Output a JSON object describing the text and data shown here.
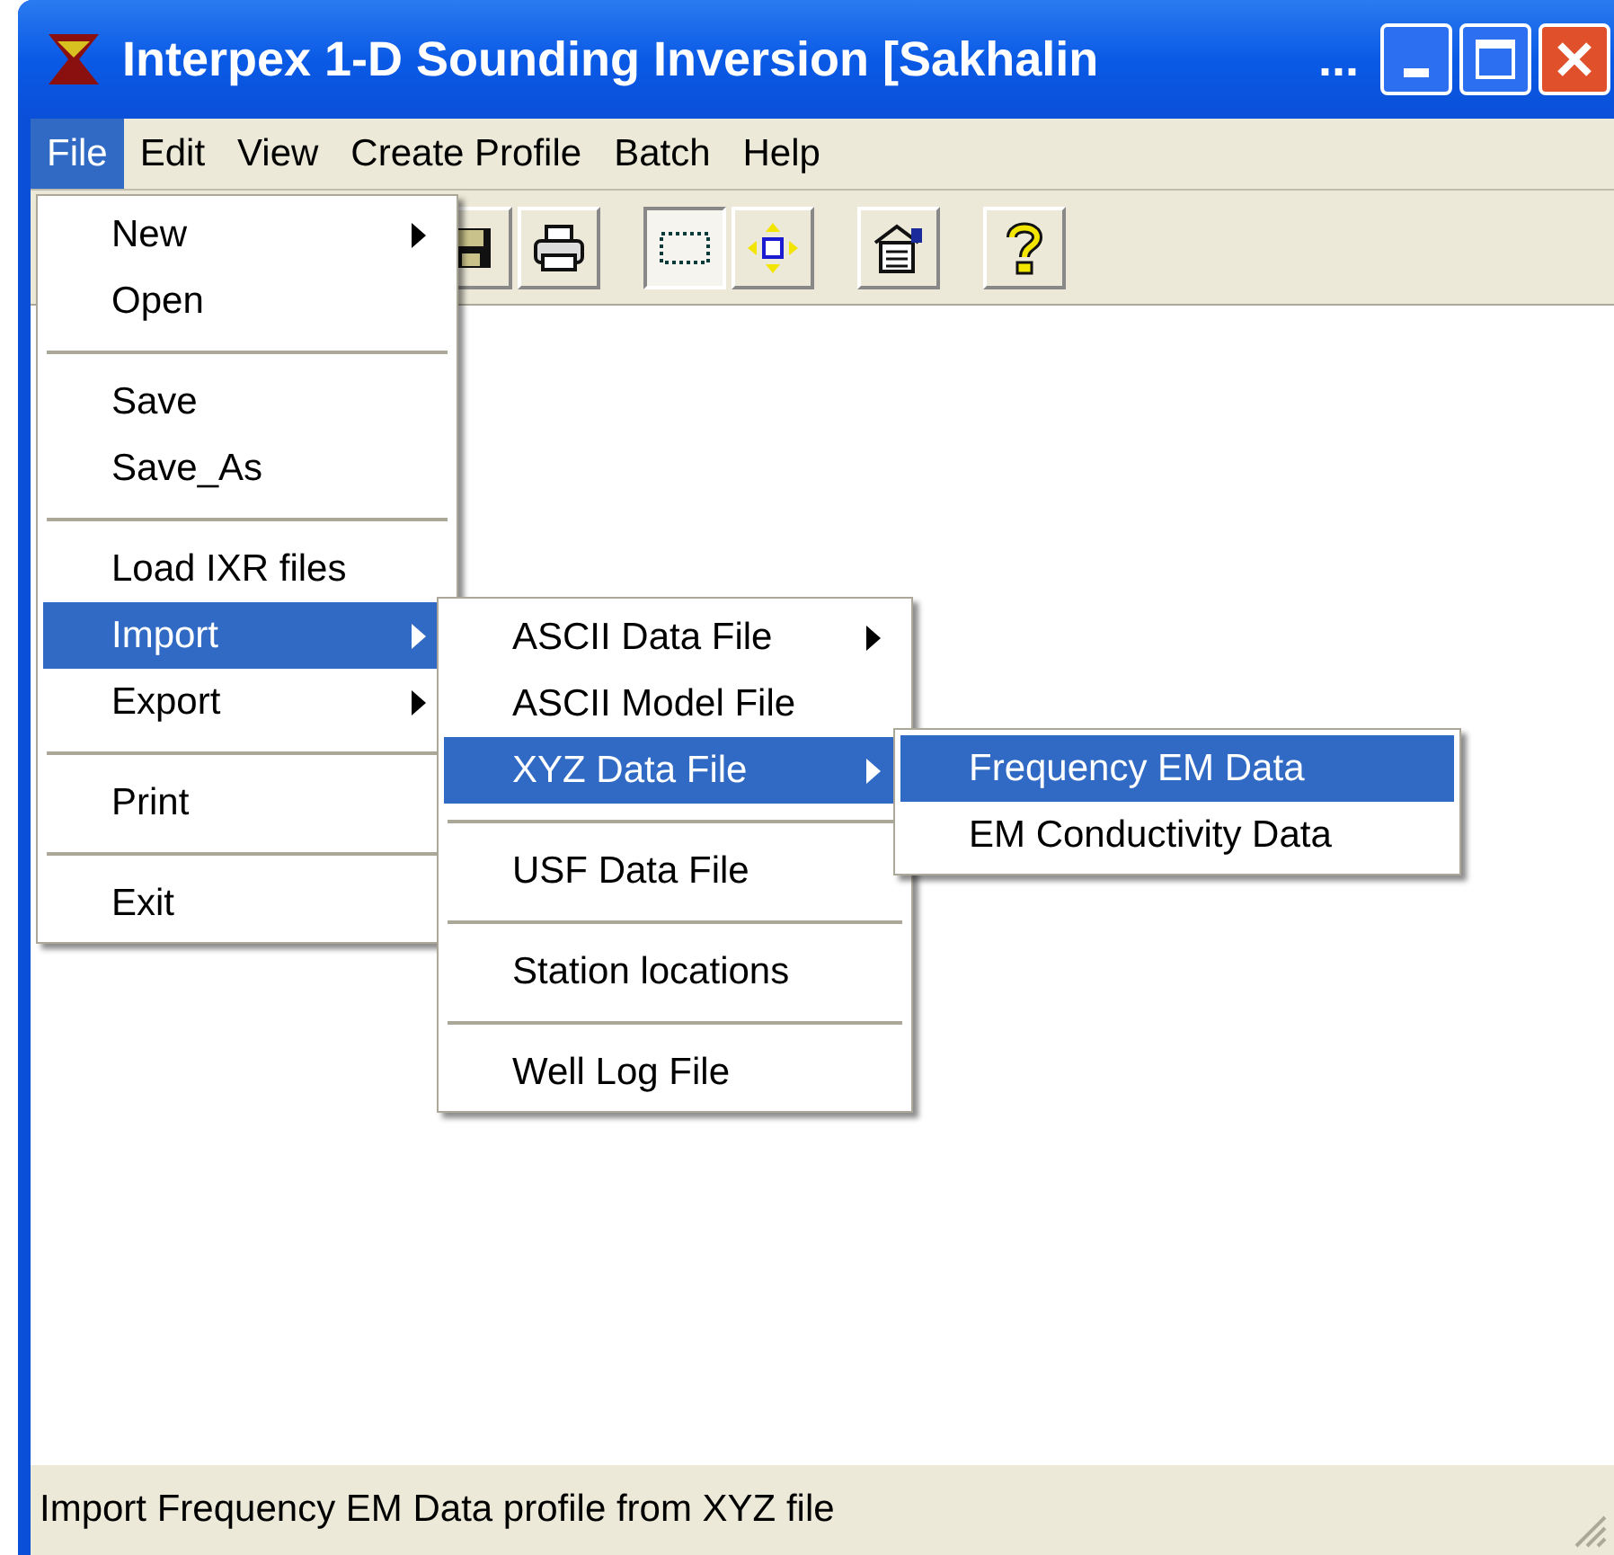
{
  "window": {
    "title": "Interpex 1-D Sounding Inversion [Sakhalin",
    "title_tail": "..."
  },
  "menu_bar": [
    {
      "label": "File",
      "selected": true
    },
    {
      "label": "Edit",
      "selected": false
    },
    {
      "label": "View",
      "selected": false
    },
    {
      "label": "Create Profile",
      "selected": false
    },
    {
      "label": "Batch",
      "selected": false
    },
    {
      "label": "Help",
      "selected": false
    }
  ],
  "toolbar": [
    {
      "kind": "save",
      "pressed": false
    },
    {
      "kind": "print",
      "pressed": false
    },
    {
      "kind": "gap"
    },
    {
      "kind": "select",
      "pressed": true
    },
    {
      "kind": "move",
      "pressed": false
    },
    {
      "kind": "gap"
    },
    {
      "kind": "properties",
      "pressed": false
    },
    {
      "kind": "gap"
    },
    {
      "kind": "help",
      "pressed": false
    }
  ],
  "file_menu": [
    {
      "kind": "item",
      "label": "New",
      "submenu": true,
      "selected": false
    },
    {
      "kind": "item",
      "label": "Open",
      "submenu": false,
      "selected": false
    },
    {
      "kind": "separator"
    },
    {
      "kind": "item",
      "label": "Save",
      "submenu": false,
      "selected": false
    },
    {
      "kind": "item",
      "label": "Save_As",
      "submenu": false,
      "selected": false
    },
    {
      "kind": "separator"
    },
    {
      "kind": "item",
      "label": "Load IXR files",
      "submenu": false,
      "selected": false
    },
    {
      "kind": "item",
      "label": "Import",
      "submenu": true,
      "selected": true
    },
    {
      "kind": "item",
      "label": "Export",
      "submenu": true,
      "selected": false
    },
    {
      "kind": "separator"
    },
    {
      "kind": "item",
      "label": "Print",
      "submenu": false,
      "selected": false
    },
    {
      "kind": "separator"
    },
    {
      "kind": "item",
      "label": "Exit",
      "submenu": false,
      "selected": false
    }
  ],
  "import_menu": [
    {
      "kind": "item",
      "label": "ASCII Data File",
      "submenu": true,
      "selected": false
    },
    {
      "kind": "item",
      "label": "ASCII Model File",
      "submenu": false,
      "selected": false
    },
    {
      "kind": "item",
      "label": "XYZ Data File",
      "submenu": true,
      "selected": true
    },
    {
      "kind": "separator"
    },
    {
      "kind": "item",
      "label": "USF Data File",
      "submenu": false,
      "selected": false
    },
    {
      "kind": "separator"
    },
    {
      "kind": "item",
      "label": "Station locations",
      "submenu": false,
      "selected": false
    },
    {
      "kind": "separator"
    },
    {
      "kind": "item",
      "label": "Well Log File",
      "submenu": false,
      "selected": false
    }
  ],
  "xyz_menu": [
    {
      "kind": "item",
      "label": "Frequency EM Data",
      "submenu": false,
      "selected": true
    },
    {
      "kind": "item",
      "label": "EM Conductivity Data",
      "submenu": false,
      "selected": false
    }
  ],
  "status_bar": {
    "text": "Import Frequency EM Data profile from XYZ file"
  }
}
